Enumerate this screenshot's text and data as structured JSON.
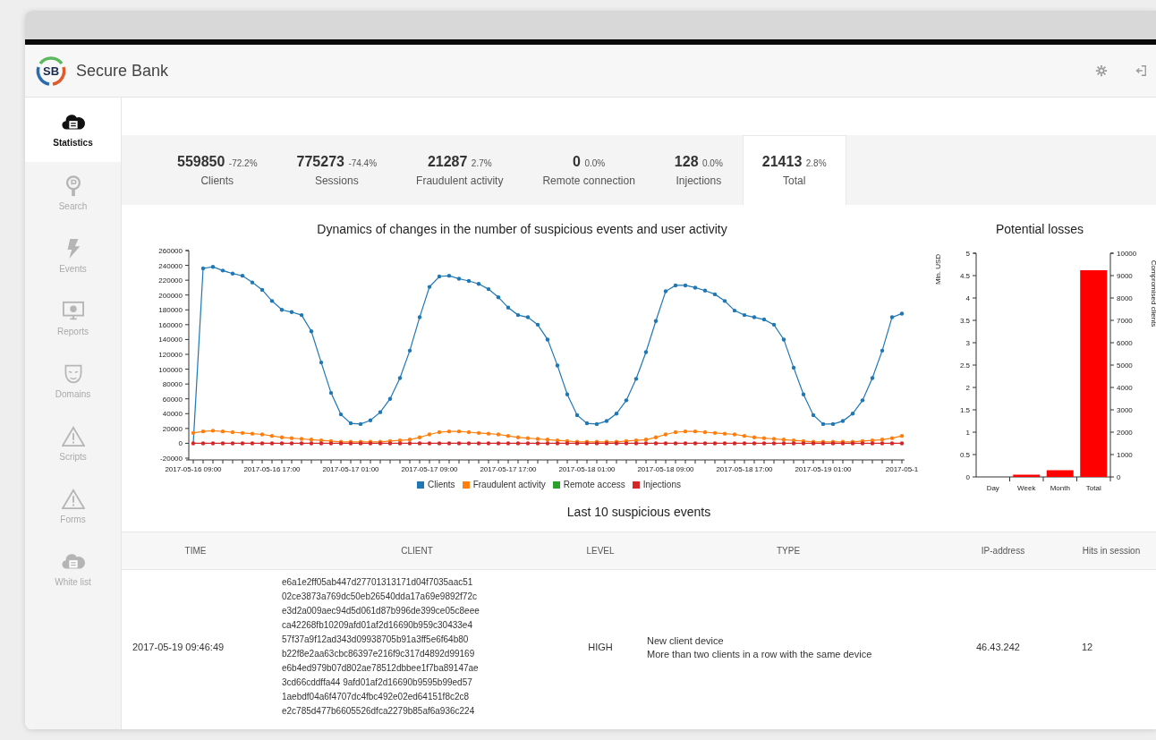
{
  "app": {
    "logo": "SB",
    "title": "Secure Bank"
  },
  "sidebar": {
    "items": [
      {
        "label": "Statistics",
        "kind": "cloud",
        "selected": true
      },
      {
        "label": "Search",
        "kind": "search",
        "selected": false
      },
      {
        "label": "Events",
        "kind": "bolt",
        "selected": false
      },
      {
        "label": "Reports",
        "kind": "monitor",
        "selected": false
      },
      {
        "label": "Domains",
        "kind": "mask",
        "selected": false
      },
      {
        "label": "Scripts",
        "kind": "warning",
        "selected": false
      },
      {
        "label": "Forms",
        "kind": "warning",
        "selected": false
      },
      {
        "label": "White list",
        "kind": "cloud",
        "selected": false
      }
    ]
  },
  "stats": [
    {
      "value": "559850",
      "change": "-72.2%",
      "label": "Clients",
      "selected": false
    },
    {
      "value": "775273",
      "change": "-74.4%",
      "label": "Sessions",
      "selected": false
    },
    {
      "value": "21287",
      "change": "2.7%",
      "label": "Fraudulent activity",
      "selected": false
    },
    {
      "value": "0",
      "change": "0.0%",
      "label": "Remote connection",
      "selected": false
    },
    {
      "value": "128",
      "change": "0.0%",
      "label": "Injections",
      "selected": false
    },
    {
      "value": "21413",
      "change": "2.8%",
      "label": "Total",
      "selected": true
    }
  ],
  "activity_chart": {
    "chart_data": {
      "type": "line",
      "title": "Dynamics of changes in the number of suspicious events and user activity",
      "categories": [
        "2017-05-16 09:00",
        null,
        null,
        null,
        null,
        null,
        null,
        null,
        "2017-05-16 17:00",
        null,
        null,
        null,
        null,
        null,
        null,
        null,
        "2017-05-17 01:00",
        null,
        null,
        null,
        null,
        null,
        null,
        null,
        "2017-05-17 09:00",
        null,
        null,
        null,
        null,
        null,
        null,
        null,
        "2017-05-17 17:00",
        null,
        null,
        null,
        null,
        null,
        null,
        null,
        "2017-05-18 01:00",
        null,
        null,
        null,
        null,
        null,
        null,
        null,
        "2017-05-18 09:00",
        null,
        null,
        null,
        null,
        null,
        null,
        null,
        "2017-05-18 17:00",
        null,
        null,
        null,
        null,
        null,
        null,
        null,
        "2017-05-19 01:00",
        null,
        null,
        null,
        null,
        null,
        null,
        null,
        "2017-05-1"
      ],
      "ylim": [
        -20000,
        260000
      ],
      "yticks": [
        -20000,
        0,
        20000,
        40000,
        60000,
        80000,
        100000,
        120000,
        140000,
        160000,
        180000,
        200000,
        220000,
        240000,
        260000
      ],
      "series": [
        {
          "name": "Clients",
          "color": "#1f77b4",
          "values": [
            0,
            236000,
            238000,
            233000,
            229000,
            226000,
            217000,
            207000,
            192000,
            180000,
            177000,
            173000,
            151000,
            109000,
            68000,
            39000,
            27000,
            26000,
            31000,
            42000,
            60000,
            88000,
            125000,
            170000,
            211000,
            225000,
            226000,
            222000,
            219000,
            215000,
            208000,
            197000,
            183000,
            173000,
            170000,
            160000,
            140000,
            105000,
            66000,
            38000,
            27000,
            26000,
            30000,
            40000,
            58000,
            87000,
            123000,
            165000,
            205000,
            213000,
            213000,
            210000,
            206000,
            201000,
            192000,
            179000,
            173000,
            170000,
            167000,
            160000,
            140000,
            102000,
            66000,
            38000,
            26000,
            26000,
            30000,
            40000,
            58000,
            88000,
            125000,
            170000,
            175000
          ]
        },
        {
          "name": "Fraudulent activity",
          "color": "#ff7f0e",
          "values": [
            14000,
            16000,
            17000,
            16000,
            15000,
            14000,
            13000,
            12000,
            10000,
            8000,
            7000,
            6000,
            5000,
            4000,
            3000,
            2000,
            2000,
            2000,
            2000,
            2000,
            3000,
            4000,
            5000,
            8000,
            12000,
            15000,
            16000,
            16000,
            15000,
            14000,
            13000,
            12000,
            10000,
            8000,
            7000,
            6000,
            5000,
            4000,
            3000,
            2000,
            2000,
            2000,
            2000,
            2000,
            3000,
            4000,
            5000,
            8000,
            12000,
            15000,
            16000,
            16000,
            15000,
            14000,
            13000,
            12000,
            10000,
            8000,
            7000,
            6000,
            5000,
            4000,
            3000,
            2000,
            2000,
            2000,
            2000,
            2000,
            3000,
            4000,
            5000,
            7000,
            10000
          ]
        },
        {
          "name": "Remote access",
          "color": "#2ca02c",
          "values": [
            null,
            null,
            null,
            null,
            null,
            null,
            null,
            null,
            null,
            null,
            null,
            null,
            null,
            null,
            null,
            null,
            null,
            null,
            null,
            null,
            null,
            null,
            null,
            null,
            null,
            null,
            null,
            null,
            null,
            null,
            null,
            null,
            null,
            null,
            null,
            null,
            null,
            null,
            null,
            null,
            null,
            null,
            null,
            null,
            null,
            null,
            null,
            null,
            null,
            null,
            null,
            null,
            null,
            null,
            null,
            null,
            null,
            null,
            null,
            null,
            null,
            null,
            null,
            null,
            null,
            null,
            null,
            null,
            null,
            null,
            null,
            null,
            null
          ]
        },
        {
          "name": "Injections",
          "color": "#d62728",
          "values": [
            0,
            0,
            0,
            0,
            0,
            0,
            0,
            0,
            0,
            0,
            0,
            0,
            0,
            0,
            0,
            0,
            0,
            0,
            0,
            0,
            0,
            0,
            0,
            0,
            0,
            0,
            0,
            0,
            0,
            0,
            0,
            0,
            0,
            0,
            0,
            0,
            0,
            0,
            0,
            0,
            0,
            0,
            0,
            0,
            0,
            0,
            0,
            0,
            0,
            0,
            0,
            0,
            0,
            0,
            0,
            0,
            0,
            0,
            0,
            0,
            0,
            0,
            0,
            0,
            0,
            0,
            0,
            0,
            0,
            0,
            0,
            0,
            0
          ]
        }
      ]
    }
  },
  "losses_chart": {
    "chart_data": {
      "type": "bar",
      "title": "Potential losses",
      "ylabel": "Mln. USD",
      "categories": [
        "Day",
        "Week",
        "Month",
        "Total"
      ],
      "values": [
        0,
        0.05,
        0.15,
        4.62
      ],
      "ylim": [
        0,
        5
      ],
      "yticks": [
        0,
        0.5,
        1,
        1.5,
        2,
        2.5,
        3,
        3.5,
        4,
        4.5,
        5
      ],
      "y2label": "Compromised clients",
      "y2lim": [
        0,
        10000
      ],
      "y2ticks": [
        0,
        1000,
        2000,
        3000,
        4000,
        5000,
        6000,
        7000,
        8000,
        9000,
        10000
      ]
    }
  },
  "events_table": {
    "title": "Last 10 suspicious events",
    "columns": [
      "TIME",
      "CLIENT",
      "LEVEL",
      "TYPE",
      "IP-address",
      "Hits in session"
    ],
    "rows": [
      {
        "time": "2017-05-19 09:46:49",
        "client": "e6a1e2ff05ab447d27701313171d04f7035aac51\n02ce3873a769dc50eb26540dda17a69e9892f72c\ne3d2a009aec94d5d061d87b996de399ce05c8eee\nca42268fb10209afd01af2d16690b959c30433e4\n57f37a9f12ad343d09938705b91a3ff5e6f64b80\nb22f8e2aa63cbc86397e216f9c317d4892d99169\ne6b4ed979b07d802ae78512dbbee1f7ba89147ae\n3cd66cddffa44 9afd01af2d16690b9595b99ed57\n1aebdf04a6f4707dc4fbc492e02ed64151f8c2c8\ne2c785d477b6605526dfca2279b85af6a936c224",
        "level": "HIGH",
        "type": [
          "New client device",
          "More than two clients in a row with the same device"
        ],
        "ip": "46.43.242",
        "hits": "12"
      }
    ]
  }
}
